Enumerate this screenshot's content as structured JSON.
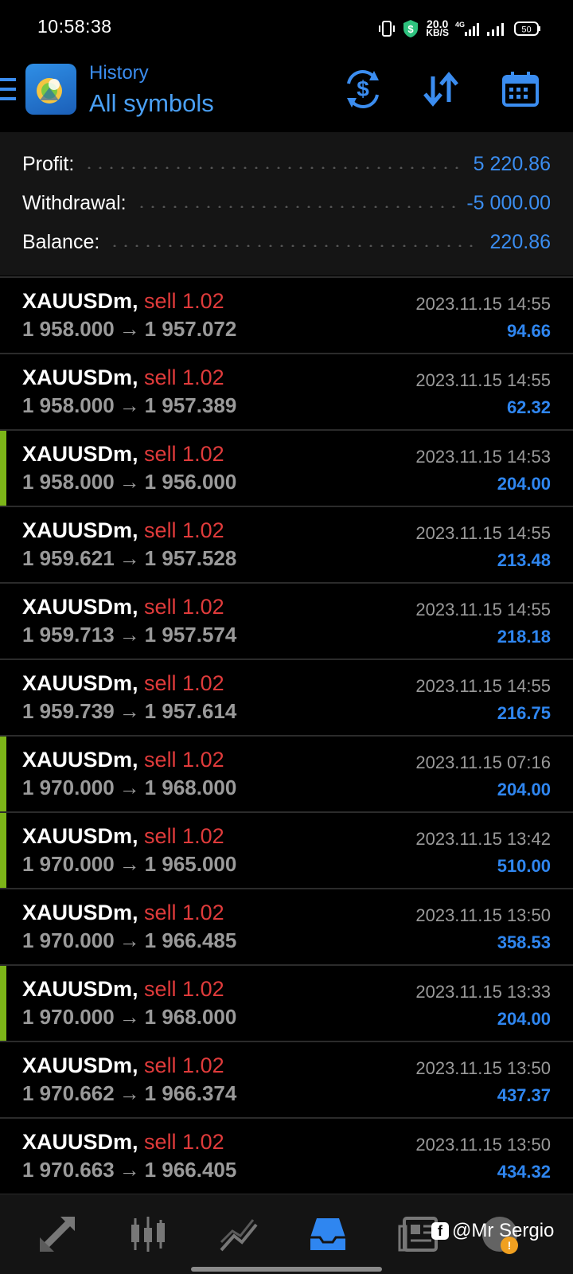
{
  "status_bar": {
    "time": "10:58:38",
    "net_speed_value": "20.0",
    "net_speed_unit": "KB/S",
    "network_type": "4G",
    "battery": "50"
  },
  "header": {
    "subtitle": "History",
    "title": "All symbols",
    "icons": [
      "menu-icon",
      "app-logo",
      "currency-exchange-icon",
      "sort-icon",
      "calendar-icon"
    ]
  },
  "summary": {
    "profit_label": "Profit:",
    "profit_value": "5 220.86",
    "withdrawal_label": "Withdrawal:",
    "withdrawal_value": "-5 000.00",
    "balance_label": "Balance:",
    "balance_value": "220.86"
  },
  "deals": [
    {
      "symbol": "XAUUSDm,",
      "action": "sell 1.02",
      "open": "1 958.000",
      "close": "1 957.072",
      "time": "2023.11.15 14:55",
      "profit": "94.66",
      "marker": false
    },
    {
      "symbol": "XAUUSDm,",
      "action": "sell 1.02",
      "open": "1 958.000",
      "close": "1 957.389",
      "time": "2023.11.15 14:55",
      "profit": "62.32",
      "marker": false
    },
    {
      "symbol": "XAUUSDm,",
      "action": "sell 1.02",
      "open": "1 958.000",
      "close": "1 956.000",
      "time": "2023.11.15 14:53",
      "profit": "204.00",
      "marker": true
    },
    {
      "symbol": "XAUUSDm,",
      "action": "sell 1.02",
      "open": "1 959.621",
      "close": "1 957.528",
      "time": "2023.11.15 14:55",
      "profit": "213.48",
      "marker": false
    },
    {
      "symbol": "XAUUSDm,",
      "action": "sell 1.02",
      "open": "1 959.713",
      "close": "1 957.574",
      "time": "2023.11.15 14:55",
      "profit": "218.18",
      "marker": false
    },
    {
      "symbol": "XAUUSDm,",
      "action": "sell 1.02",
      "open": "1 959.739",
      "close": "1 957.614",
      "time": "2023.11.15 14:55",
      "profit": "216.75",
      "marker": false
    },
    {
      "symbol": "XAUUSDm,",
      "action": "sell 1.02",
      "open": "1 970.000",
      "close": "1 968.000",
      "time": "2023.11.15 07:16",
      "profit": "204.00",
      "marker": true
    },
    {
      "symbol": "XAUUSDm,",
      "action": "sell 1.02",
      "open": "1 970.000",
      "close": "1 965.000",
      "time": "2023.11.15 13:42",
      "profit": "510.00",
      "marker": true
    },
    {
      "symbol": "XAUUSDm,",
      "action": "sell 1.02",
      "open": "1 970.000",
      "close": "1 966.485",
      "time": "2023.11.15 13:50",
      "profit": "358.53",
      "marker": false
    },
    {
      "symbol": "XAUUSDm,",
      "action": "sell 1.02",
      "open": "1 970.000",
      "close": "1 968.000",
      "time": "2023.11.15 13:33",
      "profit": "204.00",
      "marker": true
    },
    {
      "symbol": "XAUUSDm,",
      "action": "sell 1.02",
      "open": "1 970.662",
      "close": "1 966.374",
      "time": "2023.11.15 13:50",
      "profit": "437.37",
      "marker": false
    },
    {
      "symbol": "XAUUSDm,",
      "action": "sell 1.02",
      "open": "1 970.663",
      "close": "1 966.405",
      "time": "2023.11.15 13:50",
      "profit": "434.32",
      "marker": false
    }
  ],
  "bottom_nav": {
    "items": [
      "quotes-icon",
      "chart-icon",
      "trade-icon",
      "history-icon",
      "news-icon"
    ],
    "active": "history-icon"
  },
  "watermark": {
    "text": "@Mr Sergio",
    "icon": "facebook-icon"
  },
  "colors": {
    "accent_blue": "#3b8df0",
    "sell_red": "#e03b3b",
    "marker_green": "#7cb518"
  }
}
